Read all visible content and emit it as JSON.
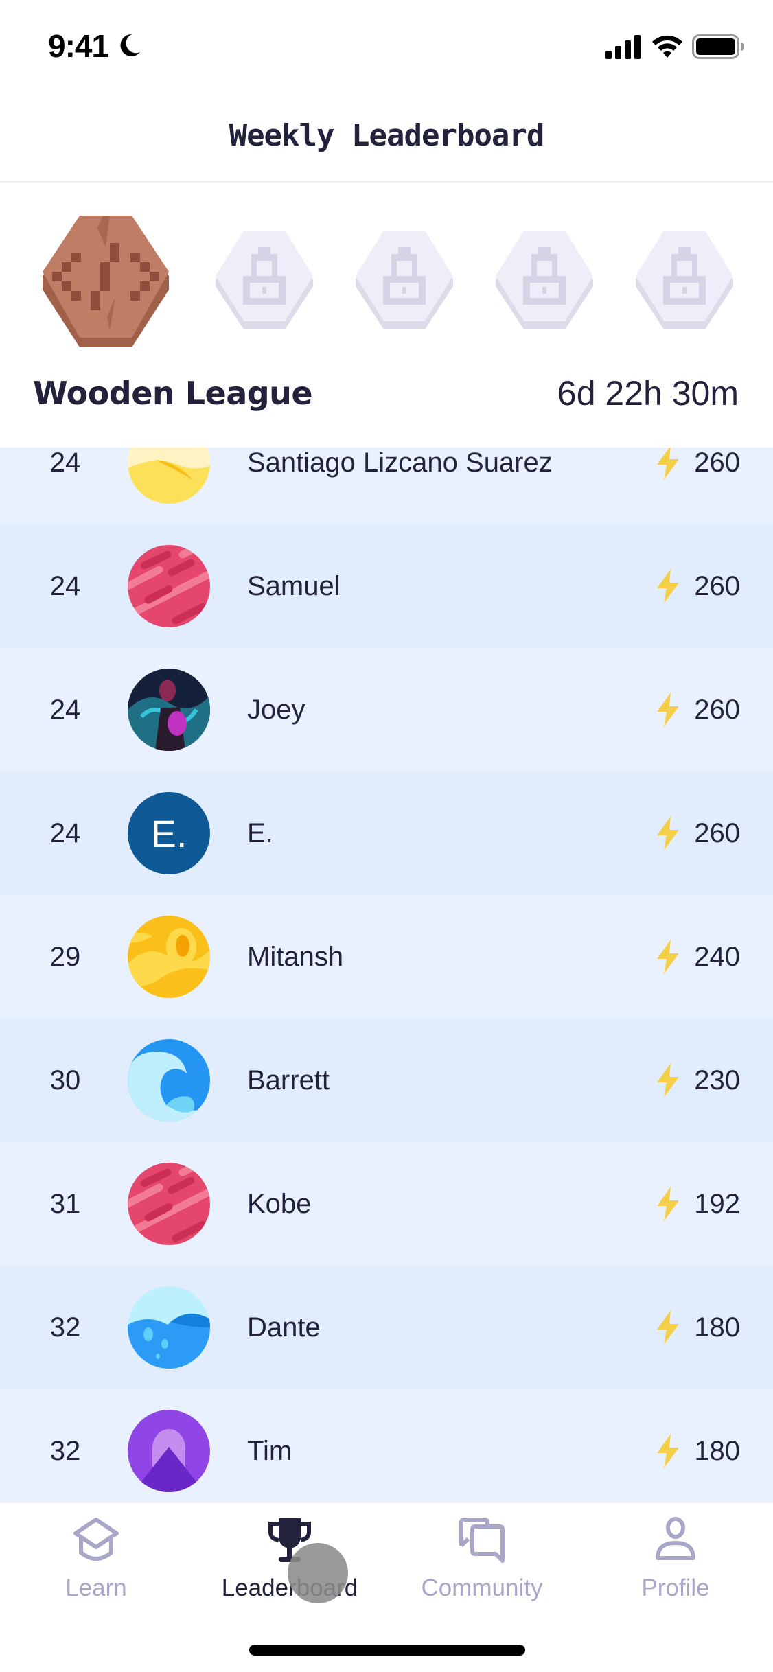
{
  "status_bar": {
    "time": "9:41"
  },
  "header": {
    "title": "Weekly Leaderboard"
  },
  "league": {
    "name": "Wooden League",
    "countdown": "6d 22h 30m",
    "badges": [
      {
        "name": "Wooden",
        "state": "current"
      },
      {
        "name": "locked",
        "state": "locked"
      },
      {
        "name": "locked",
        "state": "locked"
      },
      {
        "name": "locked",
        "state": "locked"
      },
      {
        "name": "locked",
        "state": "locked"
      }
    ]
  },
  "leaderboard": {
    "rows": [
      {
        "rank": "24",
        "name": "Santiago Lizcano Suarez",
        "score": "260",
        "avatar": "yellow-dunes"
      },
      {
        "rank": "24",
        "name": "Samuel",
        "score": "260",
        "avatar": "red-planet"
      },
      {
        "rank": "24",
        "name": "Joey",
        "score": "260",
        "avatar": "photo"
      },
      {
        "rank": "24",
        "name": "E.",
        "score": "260",
        "avatar": "initial",
        "initial": "E."
      },
      {
        "rank": "29",
        "name": "Mitansh",
        "score": "240",
        "avatar": "yellow-planet"
      },
      {
        "rank": "30",
        "name": "Barrett",
        "score": "230",
        "avatar": "wave"
      },
      {
        "rank": "31",
        "name": "Kobe",
        "score": "192",
        "avatar": "red-planet"
      },
      {
        "rank": "32",
        "name": "Dante",
        "score": "180",
        "avatar": "water"
      },
      {
        "rank": "32",
        "name": "Tim",
        "score": "180",
        "avatar": "purple-mountain"
      }
    ]
  },
  "tabs": [
    {
      "label": "Learn",
      "icon": "graduation-cap-icon",
      "active": false
    },
    {
      "label": "Leaderboard",
      "icon": "trophy-icon",
      "active": true
    },
    {
      "label": "Community",
      "icon": "chat-bubbles-icon",
      "active": false
    },
    {
      "label": "Profile",
      "icon": "person-icon",
      "active": false
    }
  ],
  "colors": {
    "text": "#22223d",
    "tab_inactive": "#a9a7c8",
    "bolt": "#f5cf47",
    "row_light": "#eaf1fe",
    "row_dark": "#e1ecfd",
    "wood": "#bf7d65"
  }
}
